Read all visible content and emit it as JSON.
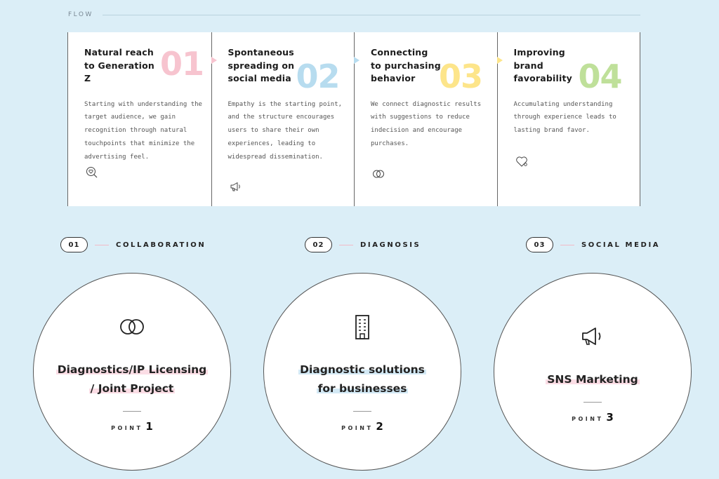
{
  "flow": {
    "label": "FLOW",
    "cards": [
      {
        "title": "Natural reach\nto Generation Z",
        "number": "01",
        "number_color": "#f7c4cf",
        "description": "Starting with understanding the\ntarget audience, we gain\nrecognition through natural\ntouchpoints that minimize the\nadvertising feel.",
        "icon": "search-heart-icon"
      },
      {
        "title": "Spontaneous\nspreading on\nsocial media",
        "number": "02",
        "number_color": "#b7dcef",
        "arrow_color": "#f7c4cf",
        "description": "Empathy is the starting point,\nand the structure encourages\nusers to share their own\nexperiences, leading to\nwidespread dissemination.",
        "icon": "megaphone-icon"
      },
      {
        "title": "Connecting\nto purchasing\nbehavior",
        "number": "03",
        "number_color": "#fde58a",
        "arrow_color": "#b7dcef",
        "description": "We connect diagnostic results\nwith suggestions to reduce\nindecision and encourage\npurchases.",
        "icon": "linked-rings-icon"
      },
      {
        "title": "Improving\nbrand\nfavorability",
        "number": "04",
        "number_color": "#bfe09a",
        "arrow_color": "#fde58a",
        "description": "Accumulating understanding\nthrough experience leads to\nlasting brand favor.",
        "icon": "heart-icon"
      }
    ]
  },
  "sections": [
    {
      "number": "01",
      "name": "COLLABORATION",
      "title_lines": [
        "Diagnostics/IP Licensing",
        "/ Joint Project"
      ],
      "highlight": "pink",
      "icon": "linked-rings-icon",
      "point_word": "POINT",
      "point_num": "1"
    },
    {
      "number": "02",
      "name": "DIAGNOSIS",
      "title_lines": [
        "Diagnostic solutions",
        "for businesses"
      ],
      "highlight": "blue",
      "icon": "building-icon",
      "point_word": "POINT",
      "point_num": "2"
    },
    {
      "number": "03",
      "name": "SOCIAL MEDIA",
      "title_lines": [
        "SNS Marketing"
      ],
      "highlight": "pink",
      "icon": "megaphone-icon",
      "point_word": "POINT",
      "point_num": "3"
    }
  ]
}
